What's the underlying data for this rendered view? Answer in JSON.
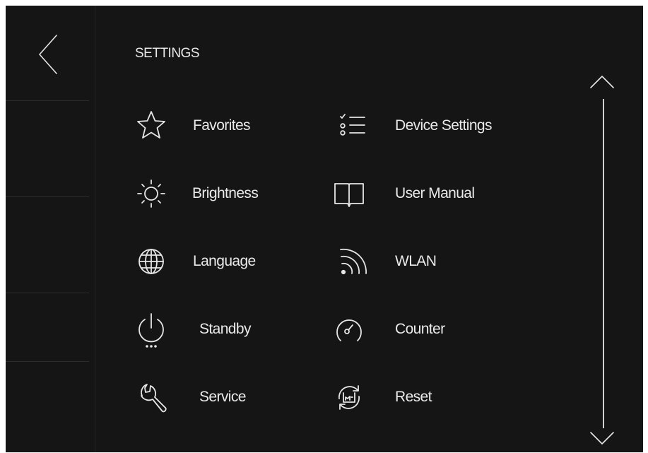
{
  "header": {
    "title": "SETTINGS"
  },
  "nav": {
    "back_icon": "chevron-left-icon"
  },
  "menu": {
    "left": [
      {
        "label": "Favorites",
        "icon": "star-icon"
      },
      {
        "label": "Brightness",
        "icon": "sun-icon"
      },
      {
        "label": "Language",
        "icon": "globe-icon"
      },
      {
        "label": "Standby",
        "icon": "power-icon"
      },
      {
        "label": "Service",
        "icon": "wrench-icon"
      }
    ],
    "right": [
      {
        "label": "Device Settings",
        "icon": "checklist-icon"
      },
      {
        "label": "User Manual",
        "icon": "book-icon"
      },
      {
        "label": "WLAN",
        "icon": "wifi-icon"
      },
      {
        "label": "Counter",
        "icon": "gauge-icon"
      },
      {
        "label": "Reset",
        "icon": "reset-icon"
      }
    ]
  },
  "scrollbar": {
    "up_icon": "chevron-up-icon",
    "down_icon": "chevron-down-icon"
  },
  "colors": {
    "background": "#151515",
    "text": "#eaeaea",
    "divider": "#2c2c2c"
  }
}
